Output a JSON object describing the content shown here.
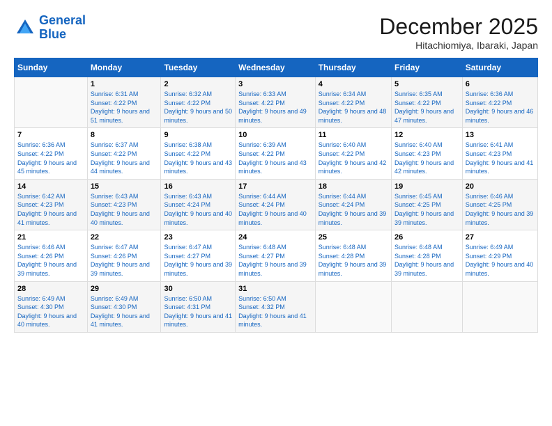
{
  "logo": {
    "line1": "General",
    "line2": "Blue"
  },
  "title": "December 2025",
  "subtitle": "Hitachiomiya, Ibaraki, Japan",
  "days_of_week": [
    "Sunday",
    "Monday",
    "Tuesday",
    "Wednesday",
    "Thursday",
    "Friday",
    "Saturday"
  ],
  "weeks": [
    [
      {
        "num": "",
        "sunrise": "",
        "sunset": "",
        "daylight": ""
      },
      {
        "num": "1",
        "sunrise": "Sunrise: 6:31 AM",
        "sunset": "Sunset: 4:22 PM",
        "daylight": "Daylight: 9 hours and 51 minutes."
      },
      {
        "num": "2",
        "sunrise": "Sunrise: 6:32 AM",
        "sunset": "Sunset: 4:22 PM",
        "daylight": "Daylight: 9 hours and 50 minutes."
      },
      {
        "num": "3",
        "sunrise": "Sunrise: 6:33 AM",
        "sunset": "Sunset: 4:22 PM",
        "daylight": "Daylight: 9 hours and 49 minutes."
      },
      {
        "num": "4",
        "sunrise": "Sunrise: 6:34 AM",
        "sunset": "Sunset: 4:22 PM",
        "daylight": "Daylight: 9 hours and 48 minutes."
      },
      {
        "num": "5",
        "sunrise": "Sunrise: 6:35 AM",
        "sunset": "Sunset: 4:22 PM",
        "daylight": "Daylight: 9 hours and 47 minutes."
      },
      {
        "num": "6",
        "sunrise": "Sunrise: 6:36 AM",
        "sunset": "Sunset: 4:22 PM",
        "daylight": "Daylight: 9 hours and 46 minutes."
      }
    ],
    [
      {
        "num": "7",
        "sunrise": "Sunrise: 6:36 AM",
        "sunset": "Sunset: 4:22 PM",
        "daylight": "Daylight: 9 hours and 45 minutes."
      },
      {
        "num": "8",
        "sunrise": "Sunrise: 6:37 AM",
        "sunset": "Sunset: 4:22 PM",
        "daylight": "Daylight: 9 hours and 44 minutes."
      },
      {
        "num": "9",
        "sunrise": "Sunrise: 6:38 AM",
        "sunset": "Sunset: 4:22 PM",
        "daylight": "Daylight: 9 hours and 43 minutes."
      },
      {
        "num": "10",
        "sunrise": "Sunrise: 6:39 AM",
        "sunset": "Sunset: 4:22 PM",
        "daylight": "Daylight: 9 hours and 43 minutes."
      },
      {
        "num": "11",
        "sunrise": "Sunrise: 6:40 AM",
        "sunset": "Sunset: 4:22 PM",
        "daylight": "Daylight: 9 hours and 42 minutes."
      },
      {
        "num": "12",
        "sunrise": "Sunrise: 6:40 AM",
        "sunset": "Sunset: 4:23 PM",
        "daylight": "Daylight: 9 hours and 42 minutes."
      },
      {
        "num": "13",
        "sunrise": "Sunrise: 6:41 AM",
        "sunset": "Sunset: 4:23 PM",
        "daylight": "Daylight: 9 hours and 41 minutes."
      }
    ],
    [
      {
        "num": "14",
        "sunrise": "Sunrise: 6:42 AM",
        "sunset": "Sunset: 4:23 PM",
        "daylight": "Daylight: 9 hours and 41 minutes."
      },
      {
        "num": "15",
        "sunrise": "Sunrise: 6:43 AM",
        "sunset": "Sunset: 4:23 PM",
        "daylight": "Daylight: 9 hours and 40 minutes."
      },
      {
        "num": "16",
        "sunrise": "Sunrise: 6:43 AM",
        "sunset": "Sunset: 4:24 PM",
        "daylight": "Daylight: 9 hours and 40 minutes."
      },
      {
        "num": "17",
        "sunrise": "Sunrise: 6:44 AM",
        "sunset": "Sunset: 4:24 PM",
        "daylight": "Daylight: 9 hours and 40 minutes."
      },
      {
        "num": "18",
        "sunrise": "Sunrise: 6:44 AM",
        "sunset": "Sunset: 4:24 PM",
        "daylight": "Daylight: 9 hours and 39 minutes."
      },
      {
        "num": "19",
        "sunrise": "Sunrise: 6:45 AM",
        "sunset": "Sunset: 4:25 PM",
        "daylight": "Daylight: 9 hours and 39 minutes."
      },
      {
        "num": "20",
        "sunrise": "Sunrise: 6:46 AM",
        "sunset": "Sunset: 4:25 PM",
        "daylight": "Daylight: 9 hours and 39 minutes."
      }
    ],
    [
      {
        "num": "21",
        "sunrise": "Sunrise: 6:46 AM",
        "sunset": "Sunset: 4:26 PM",
        "daylight": "Daylight: 9 hours and 39 minutes."
      },
      {
        "num": "22",
        "sunrise": "Sunrise: 6:47 AM",
        "sunset": "Sunset: 4:26 PM",
        "daylight": "Daylight: 9 hours and 39 minutes."
      },
      {
        "num": "23",
        "sunrise": "Sunrise: 6:47 AM",
        "sunset": "Sunset: 4:27 PM",
        "daylight": "Daylight: 9 hours and 39 minutes."
      },
      {
        "num": "24",
        "sunrise": "Sunrise: 6:48 AM",
        "sunset": "Sunset: 4:27 PM",
        "daylight": "Daylight: 9 hours and 39 minutes."
      },
      {
        "num": "25",
        "sunrise": "Sunrise: 6:48 AM",
        "sunset": "Sunset: 4:28 PM",
        "daylight": "Daylight: 9 hours and 39 minutes."
      },
      {
        "num": "26",
        "sunrise": "Sunrise: 6:48 AM",
        "sunset": "Sunset: 4:28 PM",
        "daylight": "Daylight: 9 hours and 39 minutes."
      },
      {
        "num": "27",
        "sunrise": "Sunrise: 6:49 AM",
        "sunset": "Sunset: 4:29 PM",
        "daylight": "Daylight: 9 hours and 40 minutes."
      }
    ],
    [
      {
        "num": "28",
        "sunrise": "Sunrise: 6:49 AM",
        "sunset": "Sunset: 4:30 PM",
        "daylight": "Daylight: 9 hours and 40 minutes."
      },
      {
        "num": "29",
        "sunrise": "Sunrise: 6:49 AM",
        "sunset": "Sunset: 4:30 PM",
        "daylight": "Daylight: 9 hours and 41 minutes."
      },
      {
        "num": "30",
        "sunrise": "Sunrise: 6:50 AM",
        "sunset": "Sunset: 4:31 PM",
        "daylight": "Daylight: 9 hours and 41 minutes."
      },
      {
        "num": "31",
        "sunrise": "Sunrise: 6:50 AM",
        "sunset": "Sunset: 4:32 PM",
        "daylight": "Daylight: 9 hours and 41 minutes."
      },
      {
        "num": "",
        "sunrise": "",
        "sunset": "",
        "daylight": ""
      },
      {
        "num": "",
        "sunrise": "",
        "sunset": "",
        "daylight": ""
      },
      {
        "num": "",
        "sunrise": "",
        "sunset": "",
        "daylight": ""
      }
    ]
  ]
}
